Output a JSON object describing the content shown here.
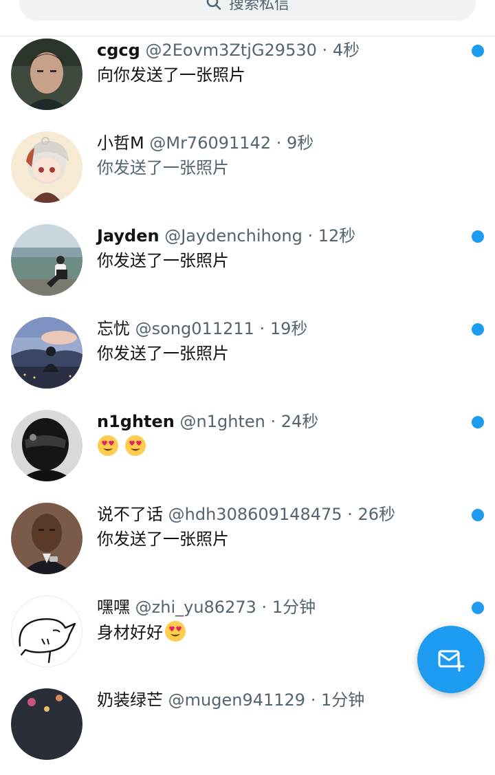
{
  "search": {
    "placeholder": "搜索私信"
  },
  "conversations": [
    {
      "name": "cgcg",
      "handle": "@2Eovm3ZtjG29530",
      "time": "4秒",
      "preview": "向你发送了一张照片",
      "unread": true
    },
    {
      "name": "小哲M",
      "handle": "@Mr76091142",
      "time": "9秒",
      "preview": "你发送了一张照片",
      "unread": false
    },
    {
      "name": "Jayden",
      "handle": "@Jaydenchihong",
      "time": "12秒",
      "preview": "你发送了一张照片",
      "unread": true
    },
    {
      "name": "忘忧",
      "handle": "@song011211",
      "time": "19秒",
      "preview": "你发送了一张照片",
      "unread": true
    },
    {
      "name": "n1ghten",
      "handle": "@n1ghten",
      "time": "24秒",
      "preview_emoji": [
        "heart-eyes-emoji",
        "heart-eyes-emoji"
      ],
      "unread": true
    },
    {
      "name": "说不了话",
      "handle": "@hdh308609148475",
      "time": "26秒",
      "preview": "你发送了一张照片",
      "unread": true
    },
    {
      "name": "嘿嘿",
      "handle": "@zhi_yu86273",
      "time": "1分钟",
      "preview": "身材好好",
      "preview_emoji": [
        "heart-eyes-emoji"
      ],
      "unread": true
    },
    {
      "name": "奶装绿芒",
      "handle": "@mugen941129",
      "time": "1分钟",
      "unread": false
    }
  ],
  "separator": "·",
  "compose_icon": "new-message-icon",
  "colors": {
    "accent": "#1d9bf0",
    "text": "#0f1419",
    "muted": "#536471",
    "search_bg": "#eff3f4"
  }
}
